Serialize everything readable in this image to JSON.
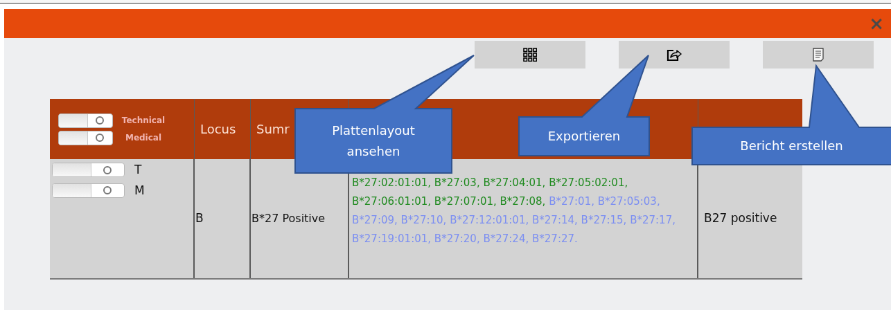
{
  "window": {
    "close_glyph": "×"
  },
  "toolbar": [
    {
      "kind": "grid"
    },
    {
      "kind": "export"
    },
    {
      "kind": "report"
    }
  ],
  "table": {
    "header_toggles": [
      {
        "label": "Technical",
        "on": false
      },
      {
        "label": "Medical",
        "on": false
      }
    ],
    "columns": [
      "Locus",
      "Sumr"
    ],
    "rows": [
      {
        "toggles": [
          {
            "label": "T",
            "on": false
          },
          {
            "label": "M",
            "on": false
          }
        ],
        "locus": "B",
        "summary": "B*27 Positive",
        "column_5": "B27 positive",
        "alleles": [
          {
            "text": "B*27:02:01:01,",
            "color": "#1f8a1f"
          },
          {
            "text": "B*27:03,",
            "color": "#1f8a1f"
          },
          {
            "text": "B*27:04:01,",
            "color": "#1f8a1f"
          },
          {
            "text": "B*27:05:02:01,",
            "color": "#1f8a1f"
          },
          {
            "text": "B*27:06:01:01,",
            "color": "#1f8a1f"
          },
          {
            "text": "B*27:07:01,",
            "color": "#1f8a1f"
          },
          {
            "text": "B*27:08,",
            "color": "#1f8a1f"
          },
          {
            "text": "B*27:01,",
            "color": "#7b8ef2"
          },
          {
            "text": "B*27:05:03,",
            "color": "#7b8ef2"
          },
          {
            "text": "B*27:09,",
            "color": "#7b8ef2"
          },
          {
            "text": "B*27:10,",
            "color": "#7b8ef2"
          },
          {
            "text": "B*27:12:01:01,",
            "color": "#7b8ef2"
          },
          {
            "text": "B*27:14,",
            "color": "#7b8ef2"
          },
          {
            "text": "B*27:15,",
            "color": "#7b8ef2"
          },
          {
            "text": "B*27:17,",
            "color": "#7b8ef2"
          },
          {
            "text": "B*27:19:01:01,",
            "color": "#7b8ef2"
          },
          {
            "text": "B*27:20,",
            "color": "#7b8ef2"
          },
          {
            "text": "B*27:24,",
            "color": "#7b8ef2"
          },
          {
            "text": "B*27:27.",
            "color": "#7b8ef2"
          }
        ]
      }
    ]
  },
  "callouts": [
    {
      "text": "Plattenlayout ansehen"
    },
    {
      "text": "Exportieren"
    },
    {
      "text": "Bericht erstellen"
    }
  ]
}
